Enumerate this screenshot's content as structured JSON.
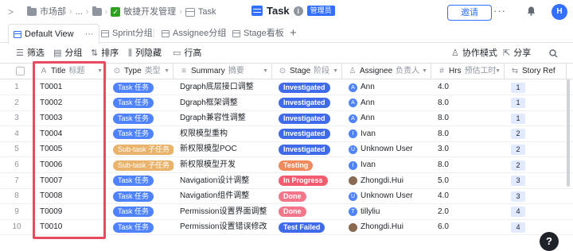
{
  "breadcrumb": {
    "items": [
      "市场部",
      "...",
      "敏捷开发管理",
      "Task"
    ]
  },
  "document": {
    "title": "Task",
    "badge": "管理员"
  },
  "header": {
    "invite_label": "邀请",
    "more_glyph": "···",
    "avatar_letter": "H"
  },
  "views": {
    "tabs": [
      {
        "label": "Default View",
        "active": true
      },
      {
        "label": "Sprint分组",
        "active": false
      },
      {
        "label": "Assignee分组",
        "active": false
      },
      {
        "label": "Stage看板",
        "active": false
      }
    ],
    "more_glyph": "···",
    "add_glyph": "+"
  },
  "toolbar": {
    "filter": "筛选",
    "group": "分组",
    "sort": "排序",
    "hide_columns": "列隐藏",
    "row_height": "行高",
    "collab_mode": "协作模式",
    "share": "分享"
  },
  "columns": [
    {
      "label": "Title",
      "sub": "标题",
      "icon": "A"
    },
    {
      "label": "Type",
      "sub": "类型",
      "icon": "⊙"
    },
    {
      "label": "Summary",
      "sub": "摘要",
      "icon": "≡"
    },
    {
      "label": "Stage",
      "sub": "阶段",
      "icon": "⊙"
    },
    {
      "label": "Assignee",
      "sub": "负责人",
      "icon": "♙"
    },
    {
      "label": "Hrs",
      "sub": "预估工时",
      "icon": "#"
    },
    {
      "label": "Story Ref",
      "sub": "",
      "icon": "⇆"
    }
  ],
  "rows": [
    {
      "num": "1",
      "title": "T0001",
      "type": "Task 任务",
      "type_kind": "task",
      "summary": "Dgraph底层接口调整",
      "stage": "Investigated",
      "stage_color": "#3f6bea",
      "assignee": "Ann",
      "avatar": "A",
      "avatar_kind": "letter",
      "hrs": "4.0",
      "ref": "1"
    },
    {
      "num": "2",
      "title": "T0002",
      "type": "Task 任务",
      "type_kind": "task",
      "summary": "Dgraph框架调整",
      "stage": "Investigated",
      "stage_color": "#3f6bea",
      "assignee": "Ann",
      "avatar": "A",
      "avatar_kind": "letter",
      "hrs": "8.0",
      "ref": "1"
    },
    {
      "num": "3",
      "title": "T0003",
      "type": "Task 任务",
      "type_kind": "task",
      "summary": "Dgraph兼容性调整",
      "stage": "Investigated",
      "stage_color": "#3f6bea",
      "assignee": "Ann",
      "avatar": "A",
      "avatar_kind": "letter",
      "hrs": "8.0",
      "ref": "1"
    },
    {
      "num": "4",
      "title": "T0004",
      "type": "Task 任务",
      "type_kind": "task",
      "summary": "权限模型重构",
      "stage": "Investigated",
      "stage_color": "#3f6bea",
      "assignee": "Ivan",
      "avatar": "I",
      "avatar_kind": "letter",
      "hrs": "8.0",
      "ref": "2"
    },
    {
      "num": "5",
      "title": "T0005",
      "type": "Sub-task 子任务",
      "type_kind": "subtask",
      "summary": "新权限模型POC",
      "stage": "Investigated",
      "stage_color": "#3f6bea",
      "assignee": "Unknown User",
      "avatar": "U",
      "avatar_kind": "letter",
      "hrs": "3.0",
      "ref": "2"
    },
    {
      "num": "6",
      "title": "T0006",
      "type": "Sub-task 子任务",
      "type_kind": "subtask",
      "summary": "新权限模型开发",
      "stage": "Testing",
      "stage_color": "#f08a5d",
      "assignee": "Ivan",
      "avatar": "I",
      "avatar_kind": "letter",
      "hrs": "8.0",
      "ref": "2"
    },
    {
      "num": "7",
      "title": "T0007",
      "type": "Task 任务",
      "type_kind": "task",
      "summary": "Navigation设计调整",
      "stage": "In Progress",
      "stage_color": "#f25c6e",
      "assignee": "Zhongdi.Hui",
      "avatar": "",
      "avatar_kind": "photo",
      "hrs": "5.0",
      "ref": "3"
    },
    {
      "num": "8",
      "title": "T0008",
      "type": "Task 任务",
      "type_kind": "task",
      "summary": "Navigation组件调整",
      "stage": "Done",
      "stage_color": "#f4768a",
      "assignee": "Unknown User",
      "avatar": "U",
      "avatar_kind": "letter",
      "hrs": "4.0",
      "ref": "3"
    },
    {
      "num": "9",
      "title": "T0009",
      "type": "Task 任务",
      "type_kind": "task",
      "summary": "Permission设置界面调整",
      "stage": "Done",
      "stage_color": "#f4768a",
      "assignee": "tillyliu",
      "avatar": "T",
      "avatar_kind": "letter",
      "hrs": "2.0",
      "ref": "4"
    },
    {
      "num": "10",
      "title": "T0010",
      "type": "Task 任务",
      "type_kind": "task",
      "summary": "Permission设置错误修改",
      "stage": "Test Failed",
      "stage_color": "#3f6bea",
      "assignee": "Zhongdi.Hui",
      "avatar": "",
      "avatar_kind": "photo",
      "hrs": "6.0",
      "ref": "4"
    }
  ],
  "help_glyph": "?"
}
